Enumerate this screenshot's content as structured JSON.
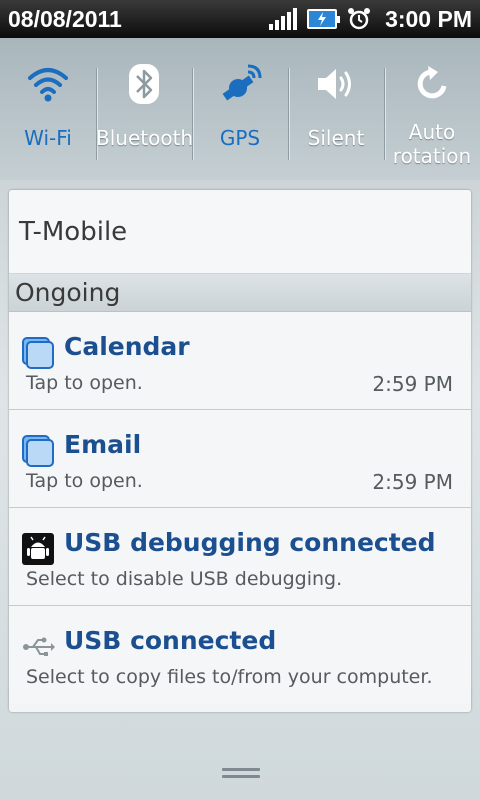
{
  "status_bar": {
    "date": "08/08/2011",
    "time": "3:00 PM",
    "icons": [
      "signal-icon",
      "battery-charging-icon",
      "alarm-icon"
    ]
  },
  "quick_settings": [
    {
      "label": "Wi-Fi",
      "icon": "wifi-icon",
      "active": true
    },
    {
      "label": "Bluetooth",
      "icon": "bluetooth-icon",
      "active": false
    },
    {
      "label": "GPS",
      "icon": "gps-icon",
      "active": true
    },
    {
      "label": "Silent",
      "icon": "speaker-icon",
      "active": false
    },
    {
      "label_line1": "Auto",
      "label_line2": "rotation",
      "icon": "rotation-icon",
      "active": false
    }
  ],
  "carrier": "T-Mobile",
  "section": "Ongoing",
  "notifications": [
    {
      "title": "Calendar",
      "subtitle": "Tap to open.",
      "time": "2:59 PM",
      "icon": "app-window-icon"
    },
    {
      "title": "Email",
      "subtitle": "Tap to open.",
      "time": "2:59 PM",
      "icon": "app-window-icon"
    },
    {
      "title": "USB debugging connected",
      "subtitle": "Select to disable USB debugging.",
      "icon": "android-debug-icon"
    },
    {
      "title": "USB connected",
      "subtitle": "Select to copy files to/from your computer.",
      "icon": "usb-icon"
    }
  ],
  "colors": {
    "active_blue": "#1a6dbf",
    "title_blue": "#1c4f8f"
  }
}
